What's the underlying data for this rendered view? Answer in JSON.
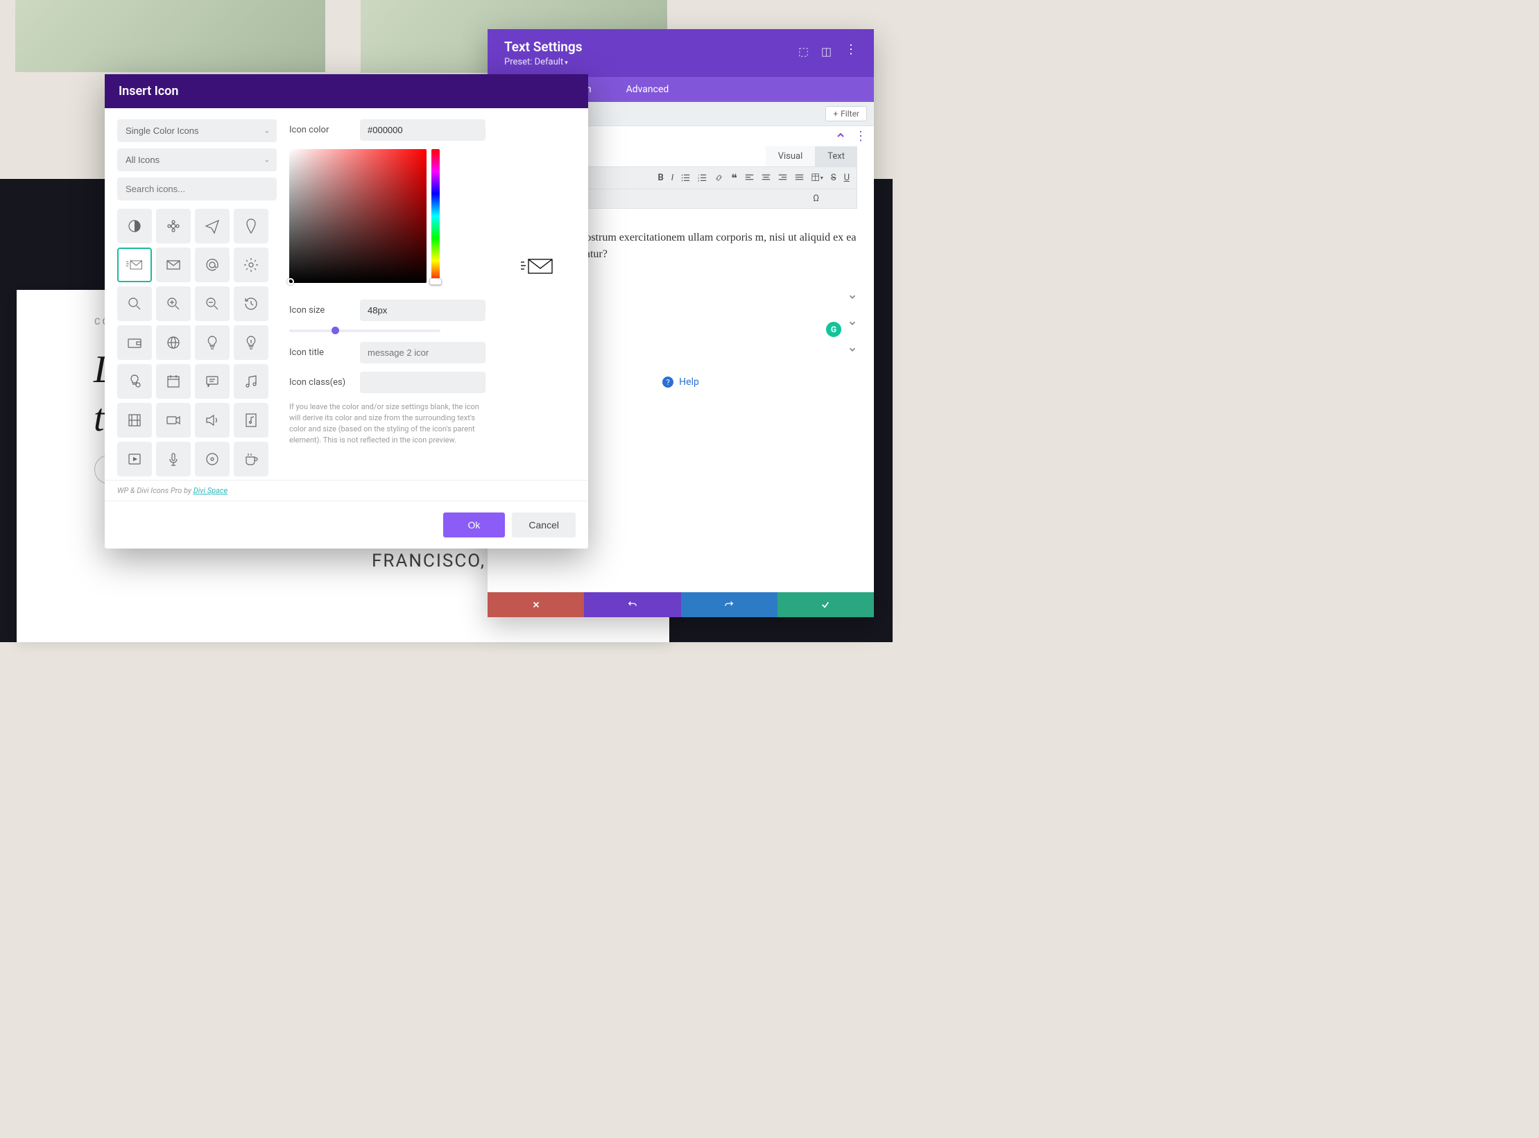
{
  "bg": {
    "eyebrow": "CC",
    "headline_1": "L",
    "headline_2": "t",
    "city": "FRANCISCO, CA"
  },
  "text_settings": {
    "title": "Text Settings",
    "preset_label": "Preset: Default",
    "tabs": {
      "design": "gn",
      "advanced": "Advanced"
    },
    "filter_btn": "Filter",
    "editor_tabs": {
      "visual": "Visual",
      "text": "Text"
    },
    "body_text": "ma veniam, quis nostrum exercitationem ullam corporis m, nisi ut aliquid ex ea commodi consequatur?",
    "help": "Help"
  },
  "modal": {
    "title": "Insert Icon",
    "dropdown1": "Single Color Icons",
    "dropdown2": "All Icons",
    "search_placeholder": "Search icons...",
    "labels": {
      "icon_color": "Icon color",
      "icon_size": "Icon size",
      "icon_title": "Icon title",
      "icon_classes": "Icon class(es)"
    },
    "values": {
      "icon_color": "#000000",
      "icon_size": "48px",
      "icon_title_placeholder": "message 2 icor"
    },
    "help_text": "If you leave the color and/or size settings blank, the icon will derive its color and size from the surrounding text's color and size (based on the styling of the icon's parent element). This is not reflected in the icon preview.",
    "credit_pre": "WP & Divi Icons Pro by ",
    "credit_link": "Divi Space",
    "ok": "Ok",
    "cancel": "Cancel"
  }
}
